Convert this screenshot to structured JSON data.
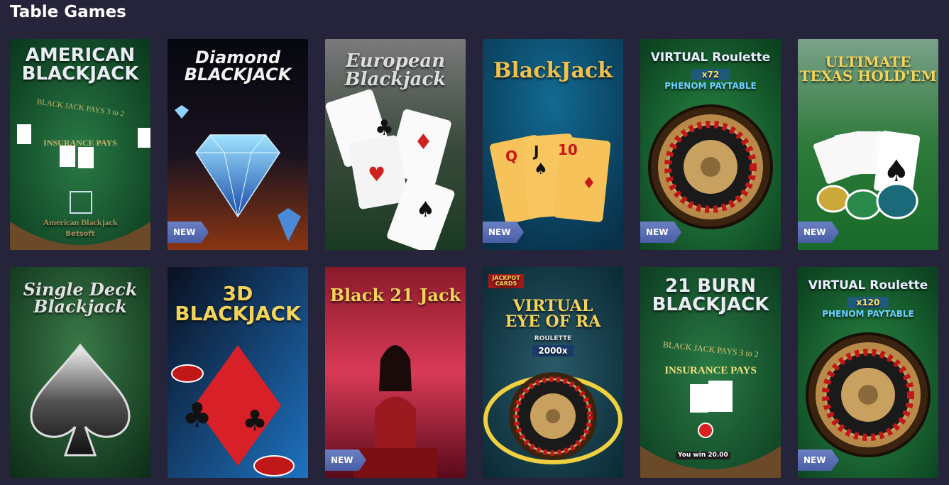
{
  "section": {
    "title": "Table Games"
  },
  "games": [
    {
      "title": "AMERICAN\nBLACKJACK",
      "sub": "American Blackjack",
      "sub2": "Betsoft",
      "new": false,
      "bg": [
        "#1d5a33",
        "#0c3a20"
      ]
    },
    {
      "title": "Diamond\nBLACKJACK",
      "new": true,
      "bg": [
        "#0a0c18",
        "#6a2a10"
      ]
    },
    {
      "title": "European\nBlackjack",
      "new": false,
      "bg": [
        "#6d6d6d",
        "#1f3a22"
      ]
    },
    {
      "title": "BlackJack",
      "new": true,
      "bg": [
        "#0d4d6e",
        "#0a3046"
      ]
    },
    {
      "title": "VIRTUAL Roulette",
      "sub": "x72",
      "sub2": "PHENOM PAYTABLE",
      "new": true,
      "bg": [
        "#1f7a3c",
        "#0e4a22"
      ]
    },
    {
      "title": "ULTIMATE\nTEXAS HOLD'EM",
      "new": true,
      "bg": [
        "#5a8a6a",
        "#1e6a2c"
      ]
    },
    {
      "title": "Single Deck\nBlackjack",
      "new": false,
      "bg": [
        "#1b5a2c",
        "#0c2e16"
      ]
    },
    {
      "title": "3D\nBLACKJACK",
      "new": false,
      "bg": [
        "#0d1a3a",
        "#1a6ab0"
      ]
    },
    {
      "title": "Black 21 Jack",
      "new": true,
      "bg": [
        "#b0203a",
        "#e0506a"
      ]
    },
    {
      "title": "VIRTUAL\nEYE OF RA",
      "sub": "ROULETTE",
      "sub2": "2000x",
      "tag": "JACKPOT CARDS",
      "new": false,
      "bg": [
        "#1e4a5a",
        "#0f2f3a"
      ]
    },
    {
      "title": "21 BURN\nBLACKJACK",
      "sub": "You win 20.00",
      "new": false,
      "bg": [
        "#1b6a34",
        "#0c3a1c"
      ]
    },
    {
      "title": "VIRTUAL Roulette",
      "sub": "x120",
      "sub2": "PHENOM PAYTABLE",
      "new": true,
      "bg": [
        "#1f7a3c",
        "#0e4a22"
      ]
    }
  ],
  "badge_label": "NEW"
}
